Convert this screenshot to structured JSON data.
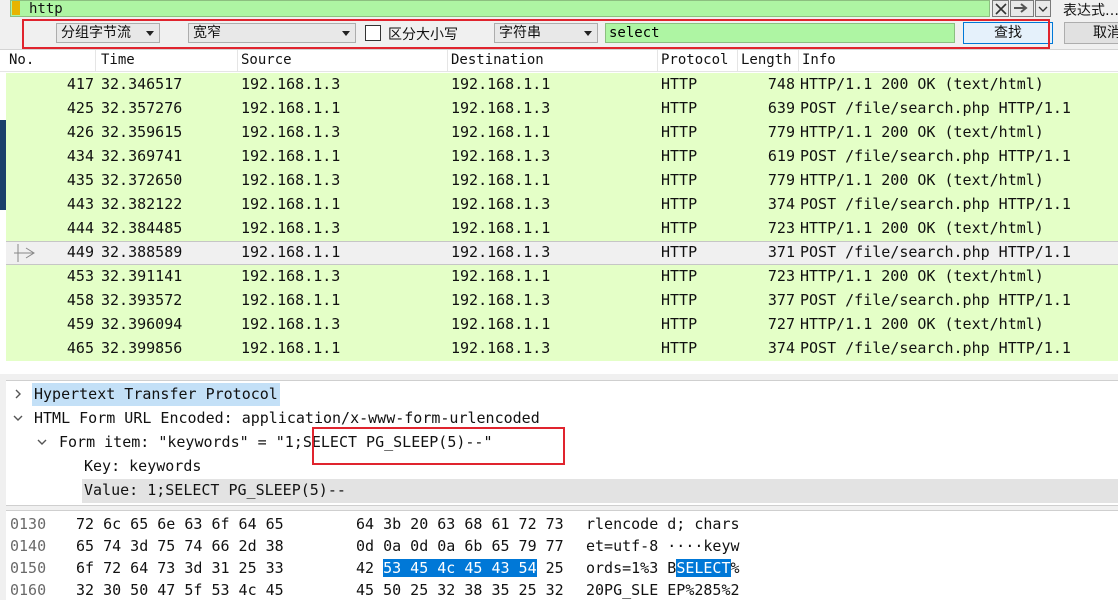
{
  "filter": {
    "value": "http",
    "expression_label": "表达式…"
  },
  "find": {
    "display_mode": "分组字节流",
    "char_width": "宽窄",
    "case_label": "区分大小写",
    "search_type": "字符串",
    "search_value": "select",
    "find_label": "查找",
    "cancel_label": "取消"
  },
  "columns": [
    "No.",
    "Time",
    "Source",
    "Destination",
    "Protocol",
    "Length",
    "Info"
  ],
  "packets": [
    {
      "no": "417",
      "time": "32.346517",
      "src": "192.168.1.3",
      "dst": "192.168.1.1",
      "proto": "HTTP",
      "len": "748",
      "info": "HTTP/1.1 200 OK  (text/html)"
    },
    {
      "no": "425",
      "time": "32.357276",
      "src": "192.168.1.1",
      "dst": "192.168.1.3",
      "proto": "HTTP",
      "len": "639",
      "info": "POST /file/search.php HTTP/1.1"
    },
    {
      "no": "426",
      "time": "32.359615",
      "src": "192.168.1.3",
      "dst": "192.168.1.1",
      "proto": "HTTP",
      "len": "779",
      "info": "HTTP/1.1 200 OK  (text/html)"
    },
    {
      "no": "434",
      "time": "32.369741",
      "src": "192.168.1.1",
      "dst": "192.168.1.3",
      "proto": "HTTP",
      "len": "619",
      "info": "POST /file/search.php HTTP/1.1"
    },
    {
      "no": "435",
      "time": "32.372650",
      "src": "192.168.1.3",
      "dst": "192.168.1.1",
      "proto": "HTTP",
      "len": "779",
      "info": "HTTP/1.1 200 OK  (text/html)"
    },
    {
      "no": "443",
      "time": "32.382122",
      "src": "192.168.1.1",
      "dst": "192.168.1.3",
      "proto": "HTTP",
      "len": "374",
      "info": "POST /file/search.php HTTP/1.1"
    },
    {
      "no": "444",
      "time": "32.384485",
      "src": "192.168.1.3",
      "dst": "192.168.1.1",
      "proto": "HTTP",
      "len": "723",
      "info": "HTTP/1.1 200 OK  (text/html)"
    },
    {
      "no": "449",
      "time": "32.388589",
      "src": "192.168.1.1",
      "dst": "192.168.1.3",
      "proto": "HTTP",
      "len": "371",
      "info": "POST /file/search.php HTTP/1.1",
      "selected": true
    },
    {
      "no": "453",
      "time": "32.391141",
      "src": "192.168.1.3",
      "dst": "192.168.1.1",
      "proto": "HTTP",
      "len": "723",
      "info": "HTTP/1.1 200 OK  (text/html)"
    },
    {
      "no": "458",
      "time": "32.393572",
      "src": "192.168.1.1",
      "dst": "192.168.1.3",
      "proto": "HTTP",
      "len": "377",
      "info": "POST /file/search.php HTTP/1.1"
    },
    {
      "no": "459",
      "time": "32.396094",
      "src": "192.168.1.3",
      "dst": "192.168.1.1",
      "proto": "HTTP",
      "len": "727",
      "info": "HTTP/1.1 200 OK  (text/html)"
    },
    {
      "no": "465",
      "time": "32.399856",
      "src": "192.168.1.1",
      "dst": "192.168.1.3",
      "proto": "HTTP",
      "len": "374",
      "info": "POST /file/search.php HTTP/1.1"
    }
  ],
  "detail": {
    "http": "Hypertext Transfer Protocol",
    "form": "HTML Form URL Encoded: application/x-www-form-urlencoded",
    "form_item": "Form item: \"keywords\" = \"1;SELECT PG_SLEEP(5)--\"",
    "key": "Key: keywords",
    "value": "Value: 1;SELECT PG_SLEEP(5)--"
  },
  "bytes": [
    {
      "offset": "0130",
      "hex1": "72 6c 65 6e 63 6f 64 65",
      "hex2a": "64 3b 20 63 68 61 72 73",
      "hex2s": "",
      "hex2b": "",
      "ascii_a": "rlencode d; chars",
      "ascii_s": "",
      "ascii_b": ""
    },
    {
      "offset": "0140",
      "hex1": "65 74 3d 75 74 66 2d 38",
      "hex2a": "0d 0a 0d 0a 6b 65 79 77",
      "hex2s": "",
      "hex2b": "",
      "ascii_a": "et=utf-8 ····keyw",
      "ascii_s": "",
      "ascii_b": ""
    },
    {
      "offset": "0150",
      "hex1": "6f 72 64 73 3d 31 25 33",
      "hex2a": "42 ",
      "hex2s": "53 45 4c 45 43 54",
      "hex2b": " 25",
      "ascii_a": "ords=1%3 B",
      "ascii_s": "SELECT",
      "ascii_b": "%"
    },
    {
      "offset": "0160",
      "hex1": "32 30 50 47 5f 53 4c 45",
      "hex2a": "45 50 25 32 38 35 25 32",
      "hex2s": "",
      "hex2b": "",
      "ascii_a": "20PG_SLE EP%285%2",
      "ascii_s": "",
      "ascii_b": ""
    }
  ],
  "colors": {
    "filter_ok": "#aef5a3",
    "row_http": "#e4ffc7",
    "selection": "#0078d7",
    "highlight_box": "#e0242e"
  }
}
